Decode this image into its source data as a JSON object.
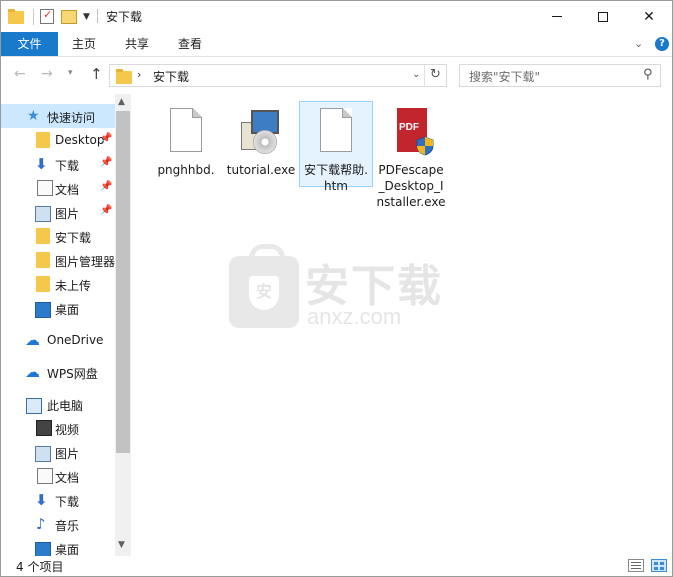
{
  "window": {
    "title": "安下载"
  },
  "ribbon": {
    "tabs": [
      {
        "label": "文件"
      },
      {
        "label": "主页"
      },
      {
        "label": "共享"
      },
      {
        "label": "查看"
      }
    ]
  },
  "address": {
    "path": "安下载",
    "search_placeholder": "搜索\"安下载\""
  },
  "sidebar": {
    "items": [
      {
        "label": "快速访问",
        "icon": "star-icon"
      },
      {
        "label": "Desktop",
        "icon": "folder-icon"
      },
      {
        "label": "下载",
        "icon": "download-icon"
      },
      {
        "label": "文档",
        "icon": "document-icon"
      },
      {
        "label": "图片",
        "icon": "picture-icon"
      },
      {
        "label": "安下载",
        "icon": "folder-icon"
      },
      {
        "label": "图片管理器",
        "icon": "folder-icon"
      },
      {
        "label": "未上传",
        "icon": "folder-icon"
      },
      {
        "label": "桌面",
        "icon": "desktop-icon"
      },
      {
        "label": "OneDrive",
        "icon": "cloud-icon"
      },
      {
        "label": "WPS网盘",
        "icon": "cloud-icon"
      },
      {
        "label": "此电脑",
        "icon": "computer-icon"
      },
      {
        "label": "视频",
        "icon": "video-icon"
      },
      {
        "label": "图片",
        "icon": "picture-icon"
      },
      {
        "label": "文档",
        "icon": "document-icon"
      },
      {
        "label": "下载",
        "icon": "download-icon"
      },
      {
        "label": "音乐",
        "icon": "music-icon"
      },
      {
        "label": "桌面",
        "icon": "desktop-icon"
      }
    ]
  },
  "files": [
    {
      "name": "pnghhbd.",
      "icon": "blank-file-icon"
    },
    {
      "name": "tutorial.exe",
      "icon": "setup-exe-icon"
    },
    {
      "name": "安下载帮助.htm",
      "icon": "blank-file-icon"
    },
    {
      "name": "PDFescape_Desktop_Installer.exe",
      "icon": "pdf-installer-icon"
    }
  ],
  "watermark": {
    "cn": "安下载",
    "en": "anxz.com",
    "badge": "安"
  },
  "pdf_icon_text": "PDF",
  "status": {
    "count": "4 个项目"
  },
  "colors": {
    "accent": "#1979ca",
    "selection": "#cce8ff"
  }
}
